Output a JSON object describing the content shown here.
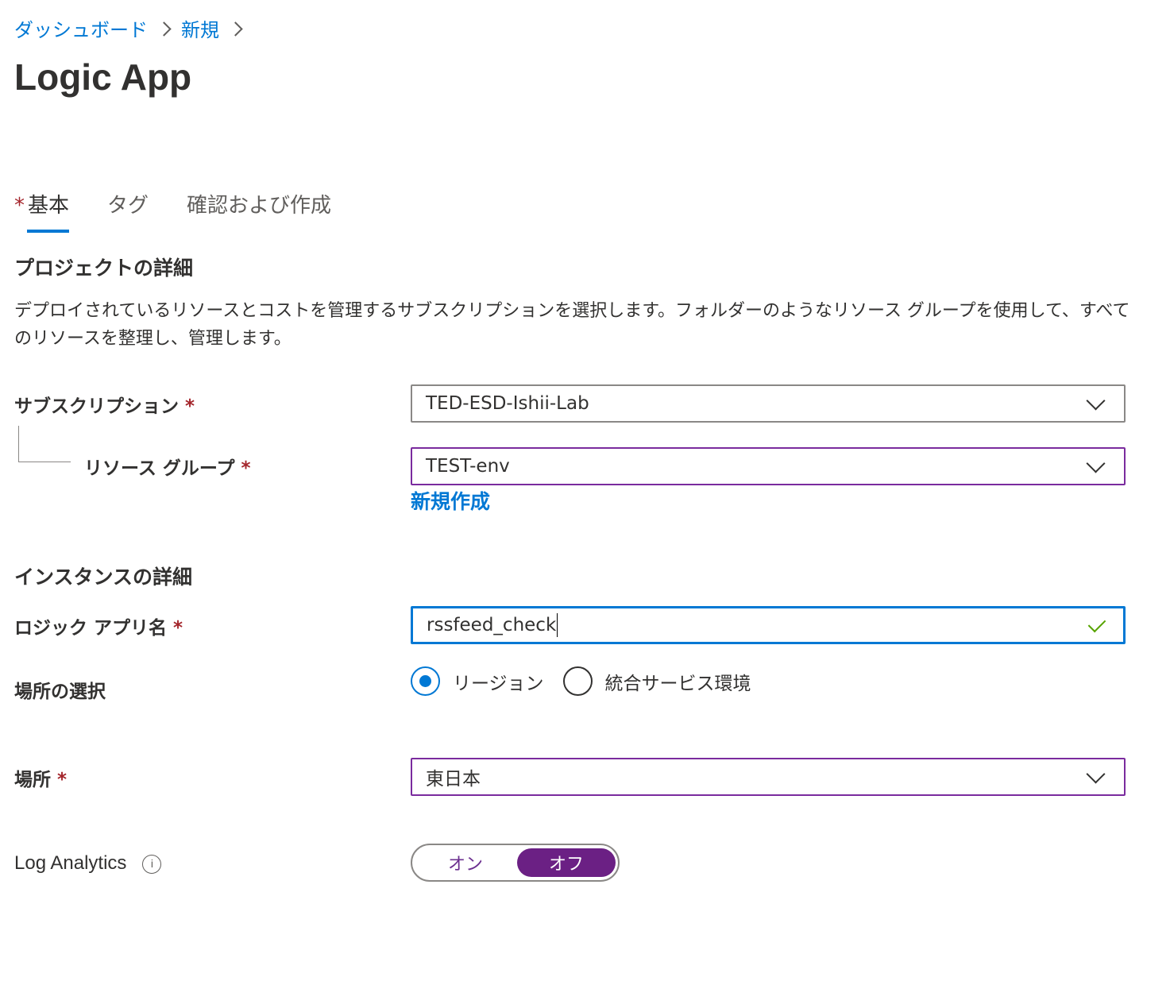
{
  "breadcrumb": {
    "item1": "ダッシュボード",
    "item2": "新規"
  },
  "page_title": "Logic App",
  "tabs": [
    {
      "label": "基本",
      "required": "*"
    },
    {
      "label": "タグ"
    },
    {
      "label": "確認および作成"
    }
  ],
  "project": {
    "title": "プロジェクトの詳細",
    "description": "デプロイされているリソースとコストを管理するサブスクリプションを選択します。フォルダーのようなリソース グループを使用して、すべてのリソースを整理し、管理します。",
    "subscription_label": "サブスクリプション",
    "subscription_value": "TED-ESD-Ishii-Lab",
    "resource_group_label": "リソース グループ",
    "resource_group_value": "TEST-env",
    "create_new_link": "新規作成"
  },
  "instance": {
    "title": "インスタンスの詳細",
    "app_name_label": "ロジック アプリ名",
    "app_name_value": "rssfeed_check",
    "location_select_label": "場所の選択",
    "radio_region": "リージョン",
    "radio_ise": "統合サービス環境",
    "location_label": "場所",
    "location_value": "東日本",
    "log_analytics_label": "Log Analytics",
    "toggle_on": "オン",
    "toggle_off": "オフ"
  },
  "required_marker": "*",
  "colors": {
    "accent": "#0078d4",
    "required": "#a4262c",
    "purple": "#6b2084",
    "valid": "#57a300"
  }
}
